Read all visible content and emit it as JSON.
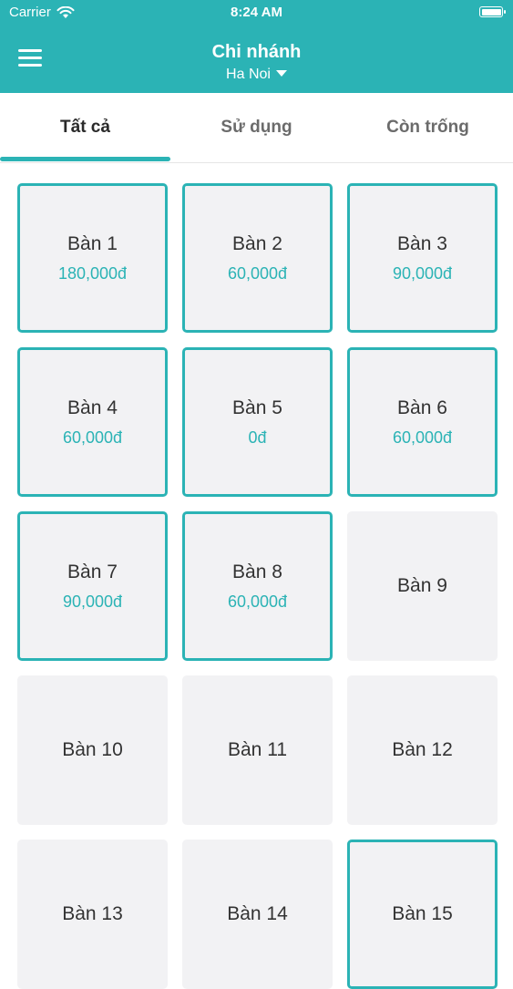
{
  "status_bar": {
    "carrier": "Carrier",
    "time": "8:24 AM"
  },
  "header": {
    "title": "Chi nhánh",
    "branch": "Ha Noi"
  },
  "tabs": [
    {
      "label": "Tất cả",
      "active": true
    },
    {
      "label": "Sử dụng",
      "active": false
    },
    {
      "label": "Còn trống",
      "active": false
    }
  ],
  "tables": [
    {
      "name": "Bàn 1",
      "price": "180,000đ",
      "used": true
    },
    {
      "name": "Bàn 2",
      "price": "60,000đ",
      "used": true
    },
    {
      "name": "Bàn 3",
      "price": "90,000đ",
      "used": true
    },
    {
      "name": "Bàn 4",
      "price": "60,000đ",
      "used": true
    },
    {
      "name": "Bàn 5",
      "price": "0đ",
      "used": true
    },
    {
      "name": "Bàn 6",
      "price": "60,000đ",
      "used": true
    },
    {
      "name": "Bàn 7",
      "price": "90,000đ",
      "used": true
    },
    {
      "name": "Bàn 8",
      "price": "60,000đ",
      "used": true
    },
    {
      "name": "Bàn 9",
      "price": "",
      "used": false
    },
    {
      "name": "Bàn 10",
      "price": "",
      "used": false
    },
    {
      "name": "Bàn 11",
      "price": "",
      "used": false
    },
    {
      "name": "Bàn 12",
      "price": "",
      "used": false
    },
    {
      "name": "Bàn 13",
      "price": "",
      "used": false
    },
    {
      "name": "Bàn 14",
      "price": "",
      "used": false
    },
    {
      "name": "Bàn 15",
      "price": "",
      "used": true
    }
  ],
  "colors": {
    "accent": "#2bb3b5",
    "tile_bg": "#f2f2f4"
  }
}
